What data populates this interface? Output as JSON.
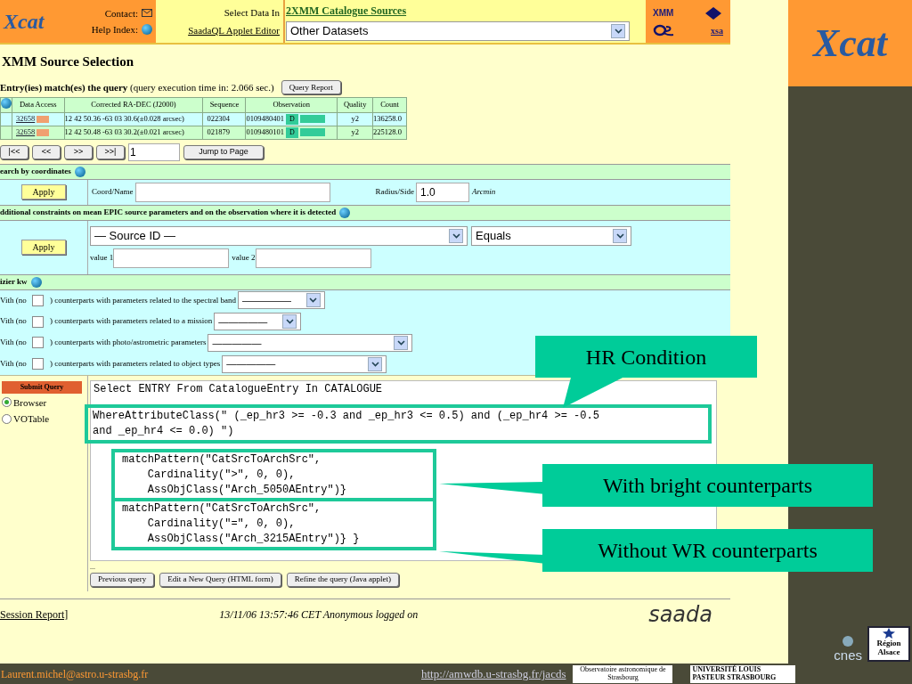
{
  "header": {
    "logo": "Xcat",
    "contact_label": "Contact:",
    "help_label": "Help Index:",
    "select_label": "Select Data In",
    "catalogue_link": "2XMM Catalogue Sources",
    "applet_link": "SaadaQL Applet Editor",
    "dataset_select": "Other Datasets",
    "mission_logo": "XMM",
    "archive_link": "xsa"
  },
  "page_title": "XMM Source Selection",
  "results": {
    "summary": "**Entry(ies) match(es) the query** (query execution time in: 2.066 sec.)",
    "report_button": "Query Report",
    "columns": [
      "Data Access",
      "Corrected RA-DEC (J2000)",
      "Sequence",
      "Observation",
      "Quality",
      "Count"
    ],
    "rows": [
      {
        "access": "32658",
        "radec": "12 42 50.36 -63 03 30.6(±0.028 arcsec)",
        "sequence": "022304",
        "observation": "0109480401",
        "flag": "D",
        "quality": "y2",
        "count": "136258.0"
      },
      {
        "access": "32658",
        "radec": "12 42 50.48 -63 03 30.2(±0.021 arcsec)",
        "sequence": "021879",
        "observation": "0109480101",
        "flag": "D",
        "quality": "y2",
        "count": "225128.0"
      }
    ]
  },
  "pager": {
    "buttons": [
      "|<<",
      "<<",
      ">>",
      ">>|"
    ],
    "page": "1",
    "jump_button": "Jump to Page"
  },
  "coordinates": {
    "title": "earch by coordinates",
    "apply": "Apply",
    "coord_label": "Coord/Name",
    "radius_label": "Radius/Side",
    "radius_value": "1.0",
    "unit": "Arcmin"
  },
  "constraints": {
    "title": "dditional constraints on mean EPIC source parameters and on the observation where it is detected",
    "apply": "Apply",
    "parameter_select": "— Source ID —",
    "operator_select": "Equals",
    "value1_label": "value 1",
    "value2_label": "value 2"
  },
  "vizier": {
    "title": "izier kw",
    "rows": [
      {
        "prefix": "Vith (no",
        "checked": false,
        "text": ") counterparts with parameters related to the spectral band",
        "select": "—————"
      },
      {
        "prefix": "Vith (no",
        "checked": false,
        "text": ") counterparts with parameters related to a mission",
        "select": "—————"
      },
      {
        "prefix": "Vith (no",
        "checked": false,
        "text": ") counterparts with photo/astrometric parameters",
        "select": "—————"
      },
      {
        "prefix": "Vith (no",
        "checked": false,
        "text": ") counterparts with parameters related to object types",
        "select": "—————"
      }
    ]
  },
  "query": {
    "submit": "Submit Query",
    "formats": [
      {
        "label": "Browser",
        "selected": true
      },
      {
        "label": "VOTable",
        "selected": false
      }
    ],
    "select_line": "Select ENTRY From CatalogueEntry In CATALOGUE",
    "hr_condition": [
      "WhereAttributeClass(\" (_ep_hr3 >= -0.3 and _ep_hr3 <= 0.5) and (_ep_hr4 >= -0.5",
      "and _ep_hr4 <= 0.0) \")"
    ],
    "patterns": [
      [
        "matchPattern(\"CatSrcToArchSrc\",",
        "    Cardinality(\">\", 0, 0),",
        "    AssObjClass(\"Arch_5050AEntry\")}"
      ],
      [
        "matchPattern(\"CatSrcToArchSrc\",",
        "    Cardinality(\"=\", 0, 0),",
        "    AssObjClass(\"Arch_3215AEntry\")} }"
      ]
    ],
    "ellipsis": "...",
    "buttons": [
      "Previous query",
      "Edit a New Query (HTML form)",
      "Refine the query (Java applet)"
    ]
  },
  "footer": {
    "session_link": "Session Report]",
    "status": "13/11/06 13:57:46 CET Anonymous logged on",
    "logo": "saada"
  },
  "callouts": [
    "HR Condition",
    "With bright counterparts",
    "Without WR counterparts"
  ],
  "slide": {
    "logo": "Xcat",
    "email": "Laurent.michel@astro.u-strasbg.fr",
    "url": "http://amwdb.u-strasbg.fr/jacds",
    "observatory": "Observatoire astronomique de Strasbourg",
    "university": "UNIVERSITÉ LOUIS PASTEUR STRASBOURG",
    "agency": "cnes",
    "region": "Région Alsace"
  }
}
